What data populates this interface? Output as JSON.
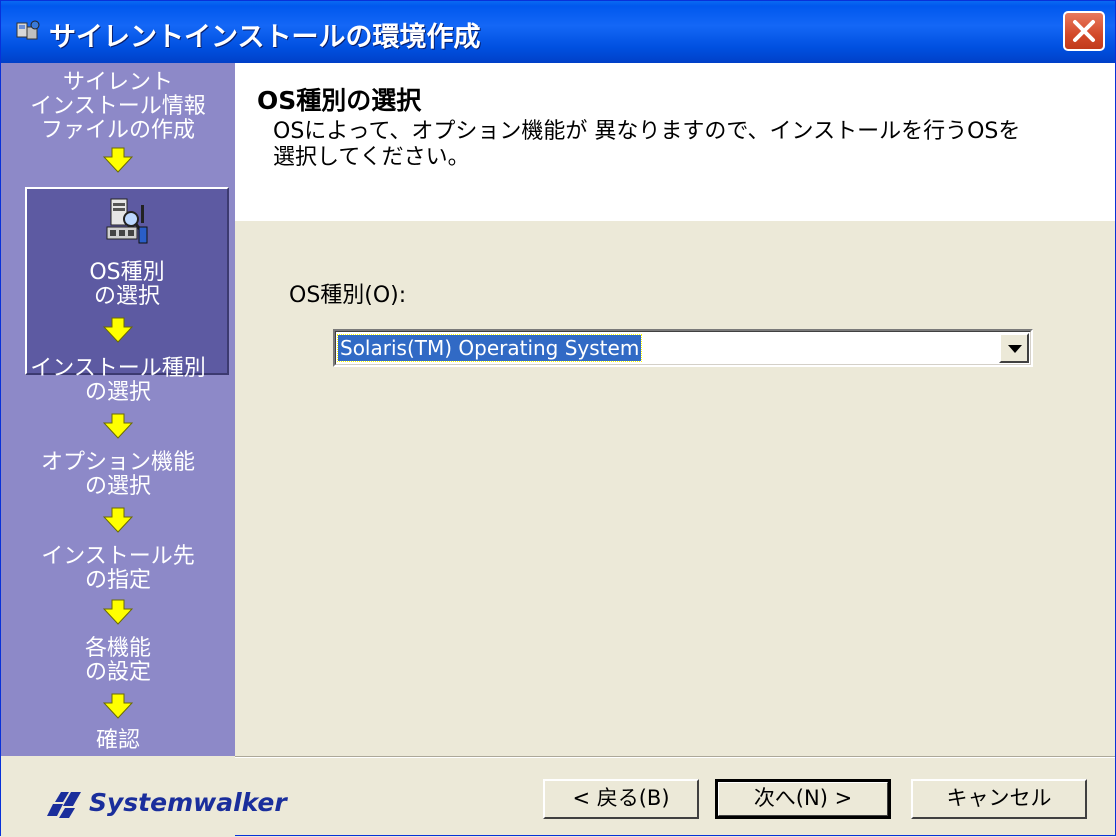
{
  "window": {
    "title": "サイレントインストールの環境作成",
    "close_label": "×"
  },
  "sidebar": {
    "steps": [
      {
        "label_lines": [
          "サイレント",
          "インストール情報",
          "ファイルの作成"
        ]
      },
      {
        "label_lines": [
          "OS種別",
          "の選択"
        ],
        "current": true
      },
      {
        "label_lines": [
          "インストール種別",
          "の選択"
        ]
      },
      {
        "label_lines": [
          "オプション機能",
          "の選択"
        ]
      },
      {
        "label_lines": [
          "インストール先",
          "の指定"
        ]
      },
      {
        "label_lines": [
          "各機能",
          "の設定"
        ]
      },
      {
        "label_lines": [
          "確認"
        ]
      }
    ]
  },
  "header": {
    "title": "OS種別の選択",
    "description_lines": [
      "OSによって、オプション機能が 異なりますので、インストールを行うOSを",
      "選択してください。"
    ]
  },
  "form": {
    "os_label": "OS種別(O):",
    "os_selected": "Solaris(TM) Operating System"
  },
  "footer": {
    "logo_text": "Systemwalker",
    "back_label": "< 戻る(B)",
    "next_label": "次へ(N) >",
    "cancel_label": "キャンセル"
  },
  "colors": {
    "sidebar_bg": "#8d89c8",
    "sidebar_current_bg": "#5d5aa2",
    "arrow": "#ffff00",
    "selection": "#316ac5",
    "titlebar": "#0058ee"
  }
}
